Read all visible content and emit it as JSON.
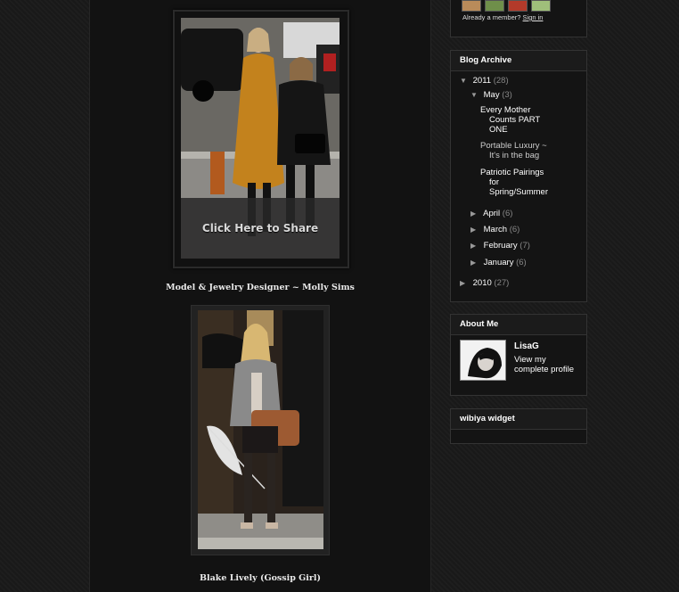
{
  "posts": [
    {
      "caption": "Model & Jewelry Designer ~ Molly Sims",
      "share_label": "Click Here to Share"
    },
    {
      "caption": "Blake Lively (Gossip Girl)"
    }
  ],
  "followers": {
    "member_prefix": "Already a member?",
    "sign_in": "Sign in"
  },
  "archive": {
    "title": "Blog Archive",
    "year_2011": {
      "label": "2011",
      "count": "(28)"
    },
    "may": {
      "label": "May",
      "count": "(3)"
    },
    "may_posts": [
      {
        "line1": "Every Mother",
        "line2": "Counts PART",
        "line3": "ONE"
      },
      {
        "line1": "Portable Luxury ~",
        "line2": "It's in the bag"
      },
      {
        "line1": "Patriotic Pairings",
        "line2": "for",
        "line3": "Spring/Summer"
      }
    ],
    "months": [
      {
        "label": "April",
        "count": "(6)"
      },
      {
        "label": "March",
        "count": "(6)"
      },
      {
        "label": "February",
        "count": "(7)"
      },
      {
        "label": "January",
        "count": "(6)"
      }
    ],
    "year_2010": {
      "label": "2010",
      "count": "(27)"
    }
  },
  "about": {
    "title": "About Me",
    "name": "LisaG",
    "profile_link_1": "View my",
    "profile_link_2": "complete profile"
  },
  "wibiya": {
    "title": "wibiya widget"
  },
  "colors": {
    "bg": "#1a1a1a",
    "column": "#121212",
    "link": "#cccccc",
    "count": "#888888"
  }
}
